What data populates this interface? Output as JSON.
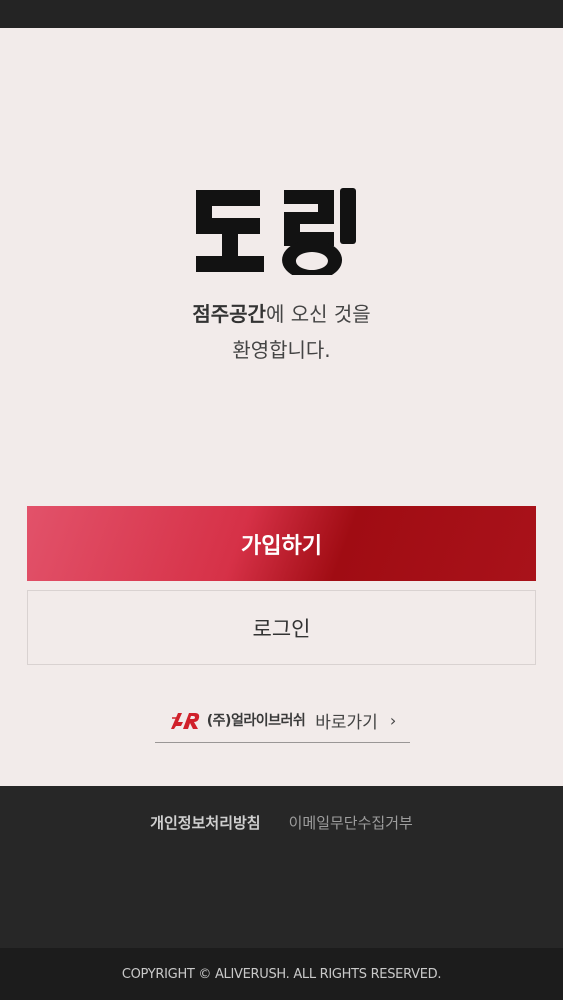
{
  "brand": {
    "logo_text": "도랑"
  },
  "welcome": {
    "highlight": "점주공간",
    "line1_rest": "에 오신 것을",
    "line2": "환영합니다."
  },
  "buttons": {
    "signup_label": "가입하기",
    "login_label": "로그인"
  },
  "shortcut": {
    "company": "(주)얼라이브러쉬",
    "go_label": "바로가기",
    "chevron": "›"
  },
  "footer": {
    "privacy_link": "개인정보처리방침",
    "email_link": "이메일무단수집거부",
    "copyright": "COPYRIGHT © ALIVERUSH. ALL RIGHTS RESERVED."
  },
  "colors": {
    "background": "#f2ebea",
    "accent_start": "#e2526a",
    "accent_end": "#a00c13",
    "footer": "#272727"
  }
}
